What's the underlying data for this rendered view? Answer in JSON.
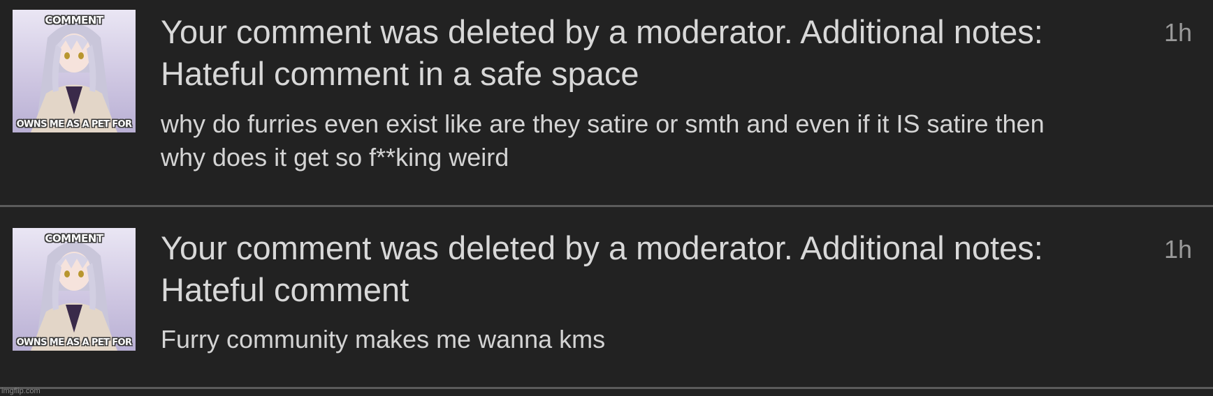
{
  "notifications": [
    {
      "thumbnail": {
        "caption_top": "COMMENT",
        "caption_bottom": "OWNS ME AS A PET FOR"
      },
      "title": "Your comment was deleted by a moderator. Additional notes: Hateful comment in a safe space",
      "comment": "why do furries even exist like are they satire or smth and even if it IS satire then why does it get so f**king weird",
      "time": "1h"
    },
    {
      "thumbnail": {
        "caption_top": "COMMENT",
        "caption_bottom": "OWNS ME AS A PET FOR"
      },
      "title": "Your comment was deleted by a moderator. Additional notes: Hateful comment",
      "comment": "Furry community makes me wanna kms",
      "time": "1h"
    }
  ],
  "watermark": "imgflip.com",
  "colors": {
    "background": "#222222",
    "divider": "#5b5b5b",
    "title_text": "#d8d8d8",
    "body_text": "#d4d4d4",
    "time_text": "#9a9a9a"
  }
}
